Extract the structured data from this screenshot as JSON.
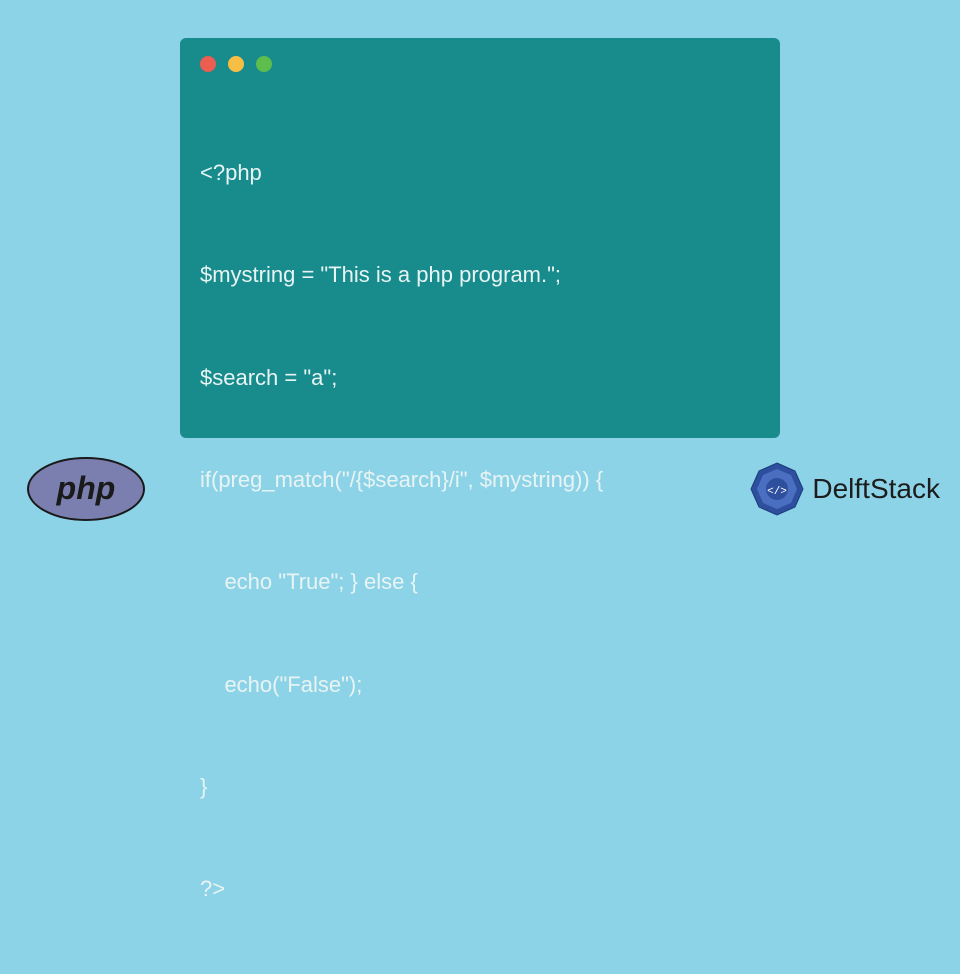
{
  "code": {
    "line1": "<?php",
    "line2": "$mystring = \"This is a php program.\";",
    "line3": "$search = \"a\";",
    "line4": "if(preg_match(\"/{$search}/i\", $mystring)) {",
    "line5": "    echo \"True\"; } else {",
    "line6": "    echo(\"False\");",
    "line7": "}",
    "line8": "?>"
  },
  "logos": {
    "php_label": "php",
    "delftstack_label": "DelftStack"
  }
}
